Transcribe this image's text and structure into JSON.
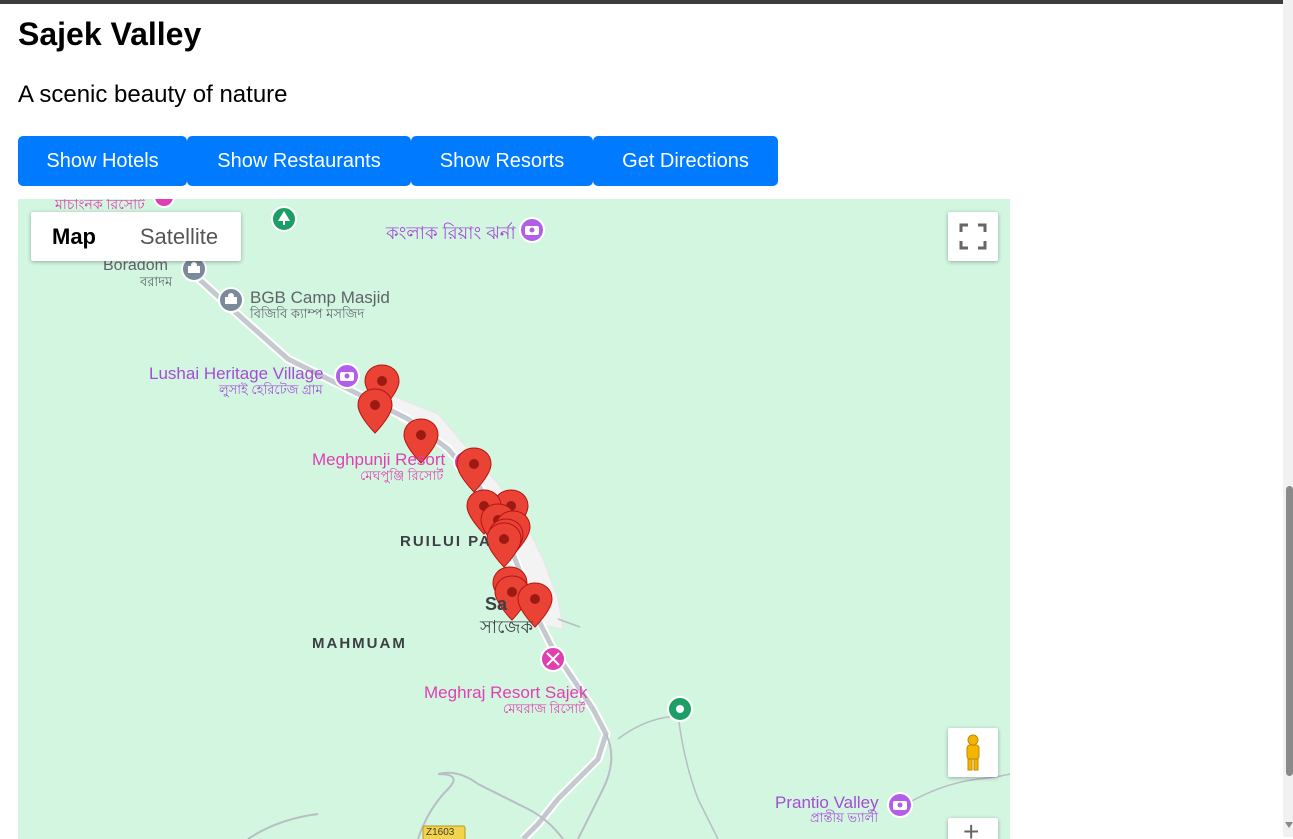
{
  "page": {
    "title": "Sajek Valley",
    "subtitle": "A scenic beauty of nature"
  },
  "buttons": {
    "hotels": "Show Hotels",
    "restaurants": "Show Restaurants",
    "resorts": "Show Resorts",
    "directions": "Get Directions"
  },
  "map": {
    "type_control": {
      "map": "Map",
      "satellite": "Satellite",
      "selected": "Map"
    },
    "labels": {
      "machang": "মাচাংনক রিসোর্ট",
      "konglak": "কংলাক রিয়াং ঝর্না",
      "boradom_en": "Boradom",
      "boradom_bn": "বরাদম",
      "bgb_en": "BGB Camp Masjid",
      "bgb_bn": "বিজিবি ক্যাম্প মসজিদ",
      "lushai_en": "Lushai Heritage Village",
      "lushai_bn": "লুসাই হেরিটেজ গ্রাম",
      "meghpunji_en": "Meghpunji Resort",
      "meghpunji_bn": "মেঘপুঞ্জি রিসোর্ট",
      "ruilui": "RUILUI PA",
      "sajek_en": "Sa",
      "sajek_bn": "সাজেক",
      "mahmuam": "MAHMUAM",
      "meghraj_en": "Meghraj Resort Sajek",
      "meghraj_bn": "মেঘরাজ রিসোর্ট",
      "prantio_en": "Prantio Valley",
      "prantio_bn": "প্রান্তীয় ভ্যালী",
      "road": "Z1603"
    },
    "zoom_in": "+",
    "icons": [
      "fullscreen-icon",
      "pegman-icon",
      "camera-icon",
      "mosque-icon",
      "tree-icon",
      "resort-icon"
    ]
  },
  "colors": {
    "button": "#007bff",
    "map_land": "#d3f6e1",
    "marker": "#ea4335",
    "poi_purple": "#a54cd6",
    "poi_pink": "#e03fb1"
  }
}
